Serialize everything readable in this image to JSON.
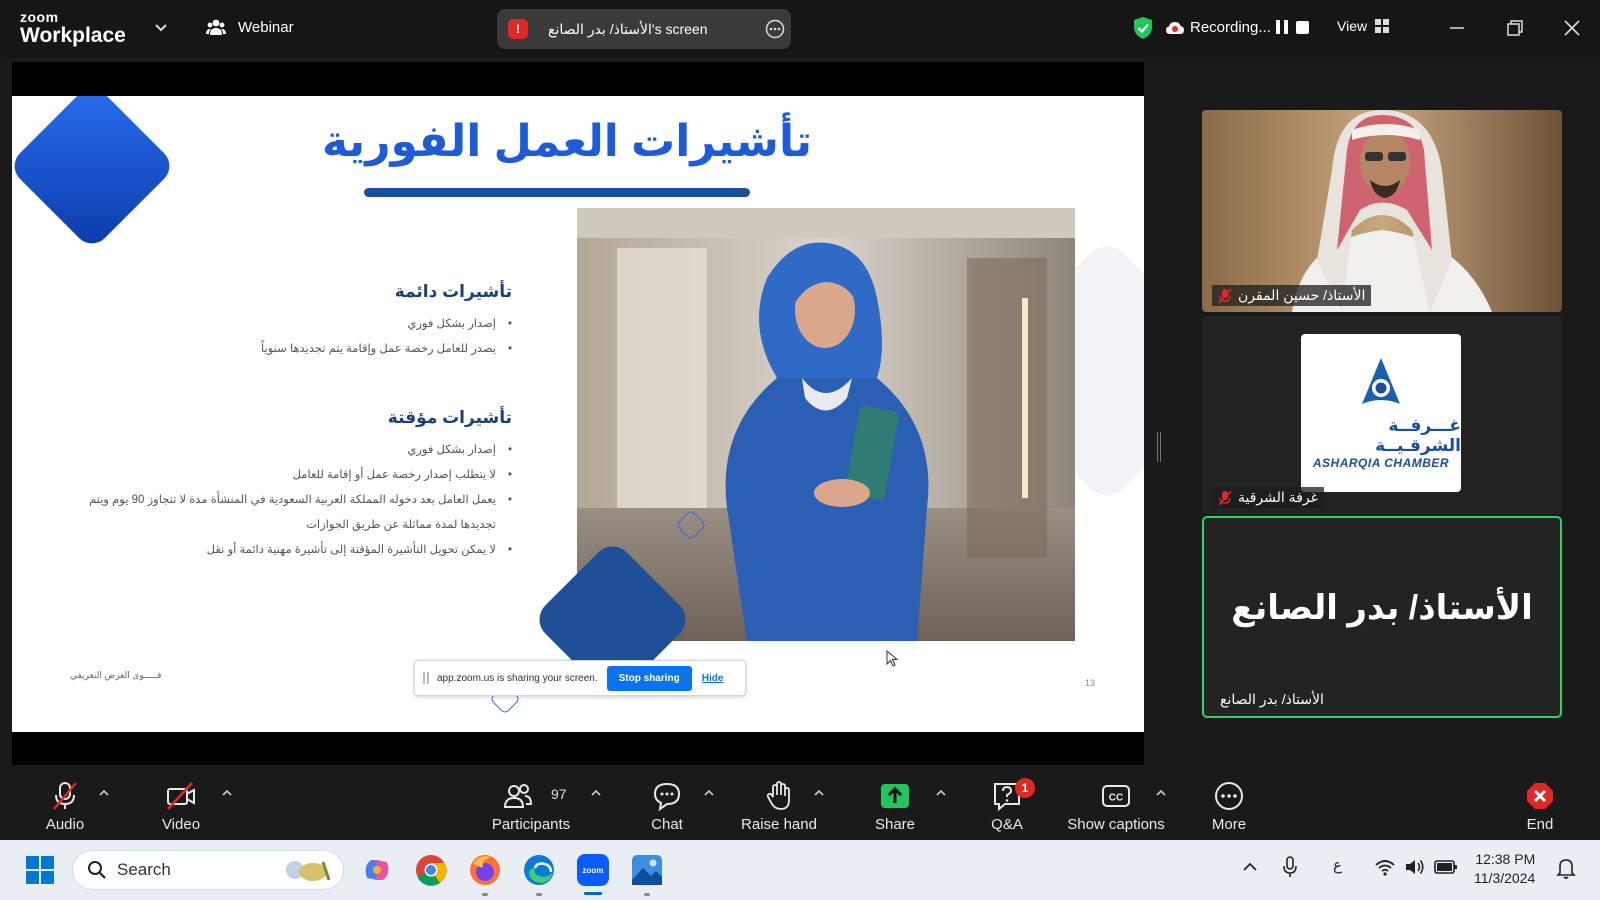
{
  "topbar": {
    "logo_line1": "zoom",
    "logo_line2": "Workplace",
    "webinar_label": "Webinar",
    "share_pill_text": "الأستاذ/ بدر الصانع's screen",
    "recording_label": "Recording...",
    "view_label": "View"
  },
  "slide": {
    "title": "تأشيرات العمل الفورية",
    "section1": {
      "heading": "تأشيرات دائمة",
      "bullets": [
        "إصدار بشكل فوري",
        "يصدر للعامل رخصة عمل وإقامة يتم تجديدها سنوياً"
      ]
    },
    "section2": {
      "heading": "تأشيرات مؤقتة",
      "bullets": [
        "إصدار بشكل فوري",
        "لا يتطلب إصدار رخصة عمل أو إقامة للعامل",
        "يعمل العامل بعد دخوله المملكة العربية السعودية في المنشأة مدة لا تتجاوز 90 يوم ويتم تجديدها لمدة مماثلة عن طريق الجوازات",
        "لا يمكن تحويل التأشيرة المؤقتة إلى تأشيرة مهنية دائمة أو نقل"
      ]
    },
    "footer_text": "فـــــوى العرض التعريفي",
    "page_number": "13"
  },
  "share_banner": {
    "message": "app.zoom.us is sharing your screen.",
    "stop_label": "Stop sharing",
    "hide_label": "Hide"
  },
  "participants": [
    {
      "name": "الأستاذ/ حسين المقرن",
      "muted": true
    },
    {
      "name": "غرفة الشرقية",
      "muted": true,
      "logo_ar": "غـــرفــة الشرقـيــة",
      "logo_en": "ASHARQIA CHAMBER"
    },
    {
      "name": "الأستاذ/ بدر الصانع",
      "display_name": "الأستاذ/ بدر الصانع",
      "muted": false
    }
  ],
  "toolbar": {
    "audio": "Audio",
    "video": "Video",
    "participants": "Participants",
    "participants_count": "97",
    "chat": "Chat",
    "raise_hand": "Raise hand",
    "share": "Share",
    "qa": "Q&A",
    "qa_badge": "1",
    "captions": "Show captions",
    "more": "More",
    "end": "End"
  },
  "taskbar": {
    "search_placeholder": "Search",
    "lang": "ع",
    "time": "12:38 PM",
    "date": "11/3/2024"
  },
  "colors": {
    "accent_blue": "#0e72ed",
    "active_speaker": "#2fd36a",
    "recording_red": "#e02828",
    "share_green": "#22c55e",
    "slide_title_blue": "#1d5bd8"
  }
}
